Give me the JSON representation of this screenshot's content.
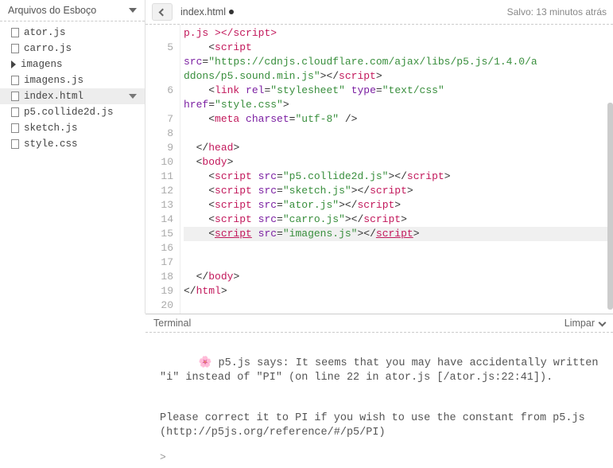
{
  "sidebar": {
    "title": "Arquivos do Esboço",
    "items": [
      {
        "label": "ator.js",
        "type": "file"
      },
      {
        "label": "carro.js",
        "type": "file"
      },
      {
        "label": "imagens",
        "type": "folder"
      },
      {
        "label": "imagens.js",
        "type": "file"
      },
      {
        "label": "index.html",
        "type": "file",
        "selected": true
      },
      {
        "label": "p5.collide2d.js",
        "type": "file"
      },
      {
        "label": "sketch.js",
        "type": "file"
      },
      {
        "label": "style.css",
        "type": "file"
      }
    ]
  },
  "editor": {
    "tab": "index.html",
    "modified": true,
    "saved_text": "Salvo: 13 minutos atrás",
    "first_line_no": 5,
    "last_line_no": 20,
    "code_lines": [
      {
        "n": null,
        "html": "<span class='c-tag'>p.js</span> <span class='c-tag'>&gt;&lt;/script&gt;</span>"
      },
      {
        "n": 5,
        "html": "    &lt;<span class='c-tag'>script</span>"
      },
      {
        "n": null,
        "html": "<span class='c-attr'>src</span>=<span class='c-str'>\"https://cdnjs.cloudflare.com/ajax/libs/p5.js/1.4.0/a</span>"
      },
      {
        "n": null,
        "html": "<span class='c-str'>ddons/p5.sound.min.js\"</span>&gt;&lt;/<span class='c-tag'>script</span>&gt;"
      },
      {
        "n": 6,
        "html": "    &lt;<span class='c-tag'>link</span> <span class='c-attr'>rel</span>=<span class='c-str'>\"stylesheet\"</span> <span class='c-attr'>type</span>=<span class='c-str'>\"text/css\"</span>"
      },
      {
        "n": null,
        "html": "<span class='c-attr'>href</span>=<span class='c-str'>\"style.css\"</span>&gt;"
      },
      {
        "n": 7,
        "html": "    &lt;<span class='c-tag'>meta</span> <span class='c-attr'>charset</span>=<span class='c-str'>\"utf-8\"</span> /&gt;"
      },
      {
        "n": 8,
        "html": ""
      },
      {
        "n": 9,
        "html": "  &lt;/<span class='c-tag'>head</span>&gt;"
      },
      {
        "n": 10,
        "html": "  &lt;<span class='c-tag'>body</span>&gt;"
      },
      {
        "n": 11,
        "html": "    &lt;<span class='c-tag'>script</span> <span class='c-attr'>src</span>=<span class='c-str'>\"p5.collide2d.js\"</span>&gt;&lt;/<span class='c-tag'>script</span>&gt;"
      },
      {
        "n": 12,
        "html": "    &lt;<span class='c-tag'>script</span> <span class='c-attr'>src</span>=<span class='c-str'>\"sketch.js\"</span>&gt;&lt;/<span class='c-tag'>script</span>&gt;"
      },
      {
        "n": 13,
        "html": "    &lt;<span class='c-tag'>script</span> <span class='c-attr'>src</span>=<span class='c-str'>\"ator.js\"</span>&gt;&lt;/<span class='c-tag'>script</span>&gt;"
      },
      {
        "n": 14,
        "html": "    &lt;<span class='c-tag'>script</span> <span class='c-attr'>src</span>=<span class='c-str'>\"carro.js\"</span>&gt;&lt;/<span class='c-tag'>script</span>&gt;"
      },
      {
        "n": 15,
        "html": "    &lt;<span class='c-tag c-u'>script</span> <span class='c-attr'>src</span>=<span class='c-str'>\"imagens.js\"</span>&gt;&lt;/<span class='c-tag c-u'>script</span>&gt;",
        "hl": true
      },
      {
        "n": 16,
        "html": ""
      },
      {
        "n": 17,
        "html": ""
      },
      {
        "n": 18,
        "html": "  &lt;/<span class='c-tag'>body</span>&gt;"
      },
      {
        "n": 19,
        "html": "&lt;/<span class='c-tag'>html</span>&gt;"
      },
      {
        "n": 20,
        "html": ""
      }
    ]
  },
  "terminal": {
    "title": "Terminal",
    "clear_label": "Limpar",
    "flower": "🌸",
    "message1": "p5.js says: It seems that you may have accidentally written \"i\" instead of \"PI\" (on line 22 in ator.js [/ator.js:22:41]).",
    "message2": "Please correct it to PI if you wish to use the constant from p5.js (http://p5js.org/reference/#/p5/PI)",
    "prompt": ">"
  }
}
